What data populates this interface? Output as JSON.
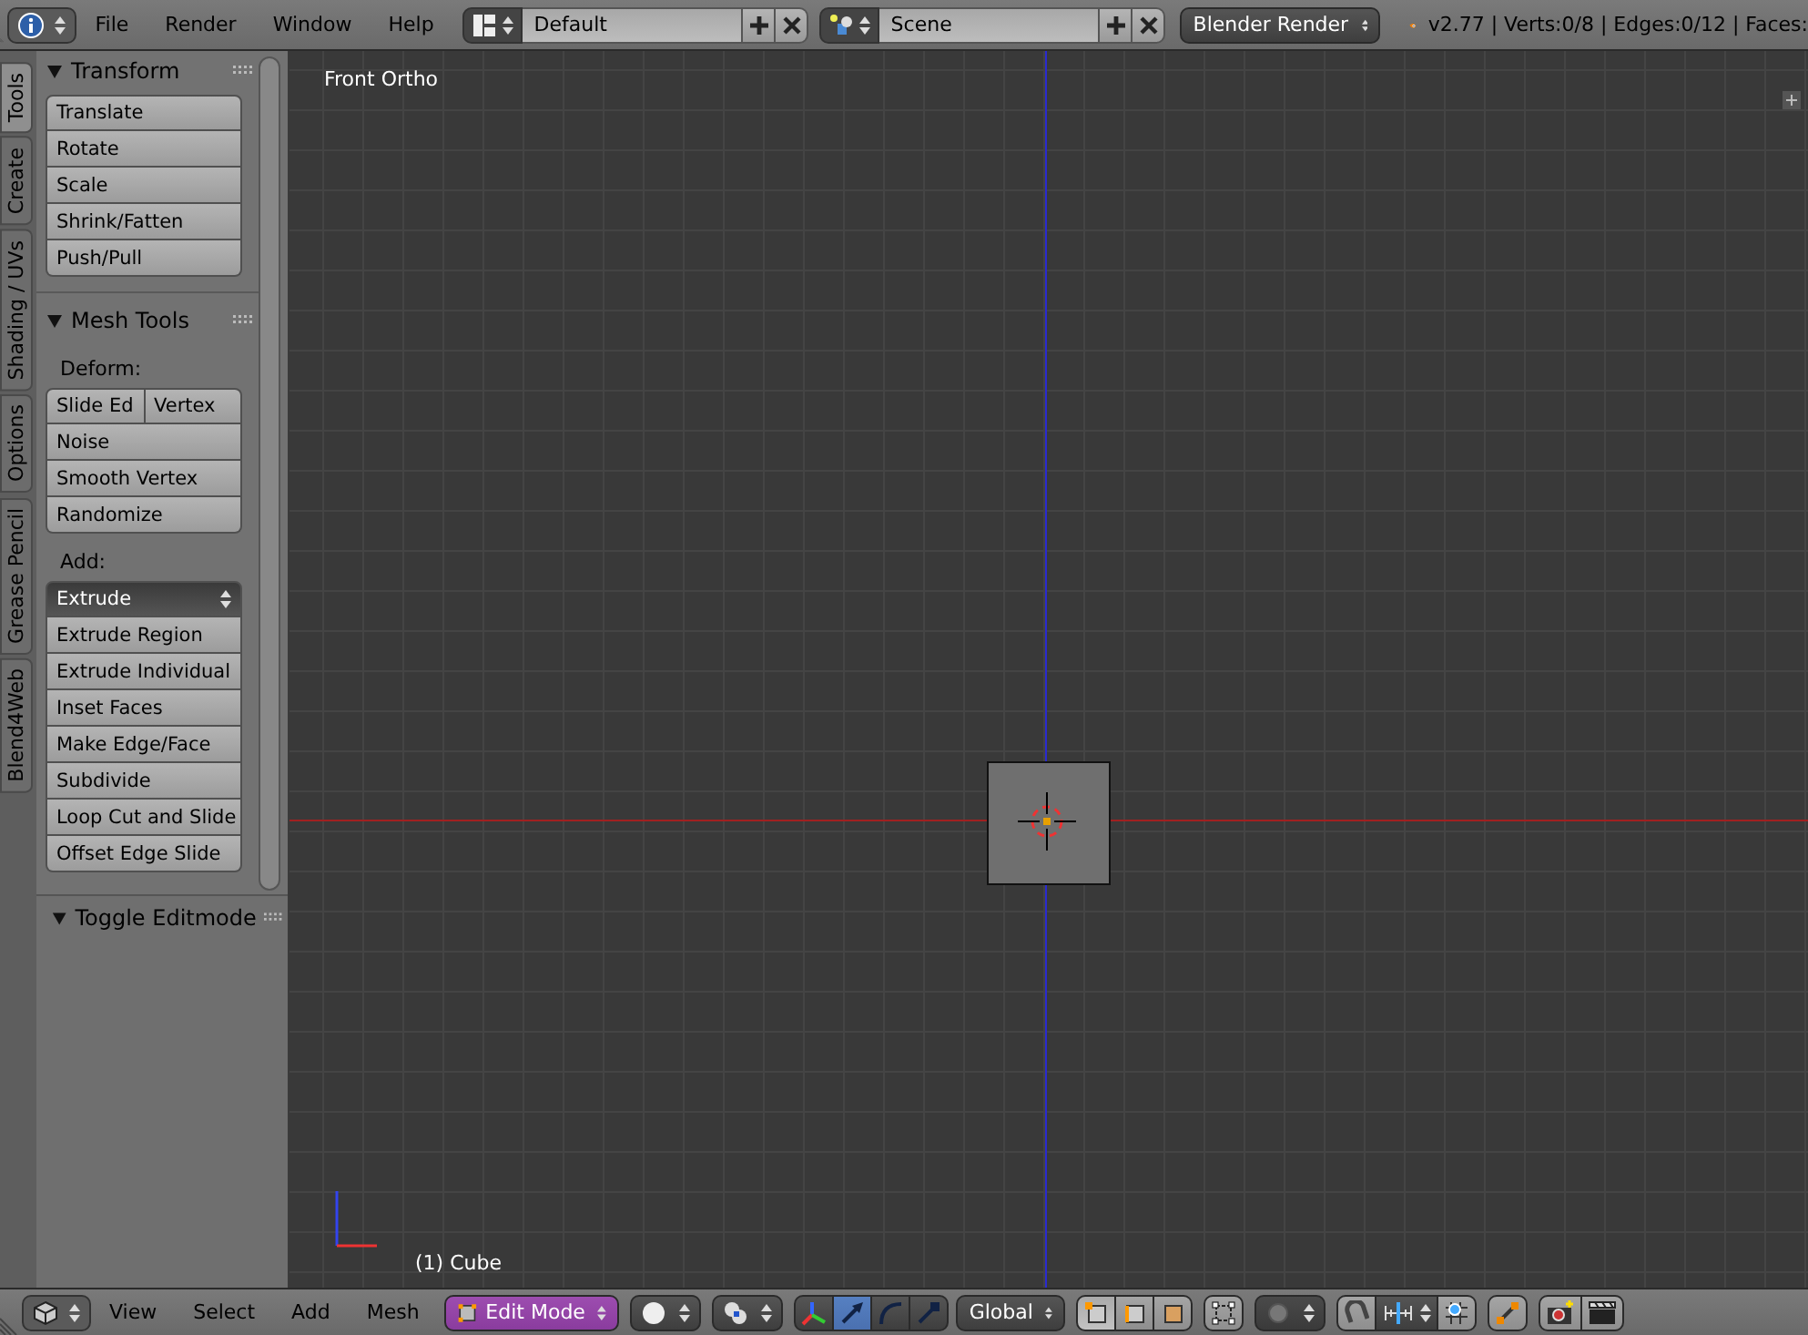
{
  "top_bar": {
    "menus": [
      "File",
      "Render",
      "Window",
      "Help"
    ],
    "screen_layout": "Default",
    "scene": "Scene",
    "render_engine": "Blender Render",
    "stats": "v2.77 | Verts:0/8 | Edges:0/12 | Faces:"
  },
  "tool_tabs": [
    {
      "label": "Tools",
      "selected": true
    },
    {
      "label": "Create",
      "selected": false
    },
    {
      "label": "Shading / UVs",
      "selected": false
    },
    {
      "label": "Options",
      "selected": false
    },
    {
      "label": "Grease Pencil",
      "selected": false
    },
    {
      "label": "Blend4Web",
      "selected": false
    }
  ],
  "transform_panel": {
    "title": "Transform",
    "expanded": true,
    "buttons": [
      "Translate",
      "Rotate",
      "Scale",
      "Shrink/Fatten",
      "Push/Pull"
    ]
  },
  "mesh_tools_panel": {
    "title": "Mesh Tools",
    "expanded": true,
    "deform_label": "Deform:",
    "deform_row": [
      "Slide Ed",
      "Vertex"
    ],
    "deform_buttons": [
      "Noise",
      "Smooth Vertex",
      "Randomize"
    ],
    "add_label": "Add:",
    "add_dropdown": "Extrude",
    "add_buttons": [
      "Extrude Region",
      "Extrude Individual",
      "Inset Faces",
      "Make Edge/Face",
      "Subdivide",
      "Loop Cut and Slide",
      "Offset Edge Slide"
    ]
  },
  "operator_panel": {
    "title": "Toggle Editmode",
    "expanded": true
  },
  "viewport": {
    "view_label": "Front Ortho",
    "object_label": "(1) Cube"
  },
  "bottom_bar": {
    "menus": [
      "View",
      "Select",
      "Add",
      "Mesh"
    ],
    "mode": "Edit Mode",
    "manipulators": [
      {
        "kind": "axes",
        "selected": false
      },
      {
        "kind": "translate",
        "selected": true
      },
      {
        "kind": "rotate",
        "selected": false
      },
      {
        "kind": "scale",
        "selected": false
      }
    ],
    "orientation": "Global",
    "select_modes": [
      {
        "kind": "vertex",
        "selected": true
      },
      {
        "kind": "edge",
        "selected": false
      },
      {
        "kind": "face",
        "selected": false
      }
    ]
  }
}
